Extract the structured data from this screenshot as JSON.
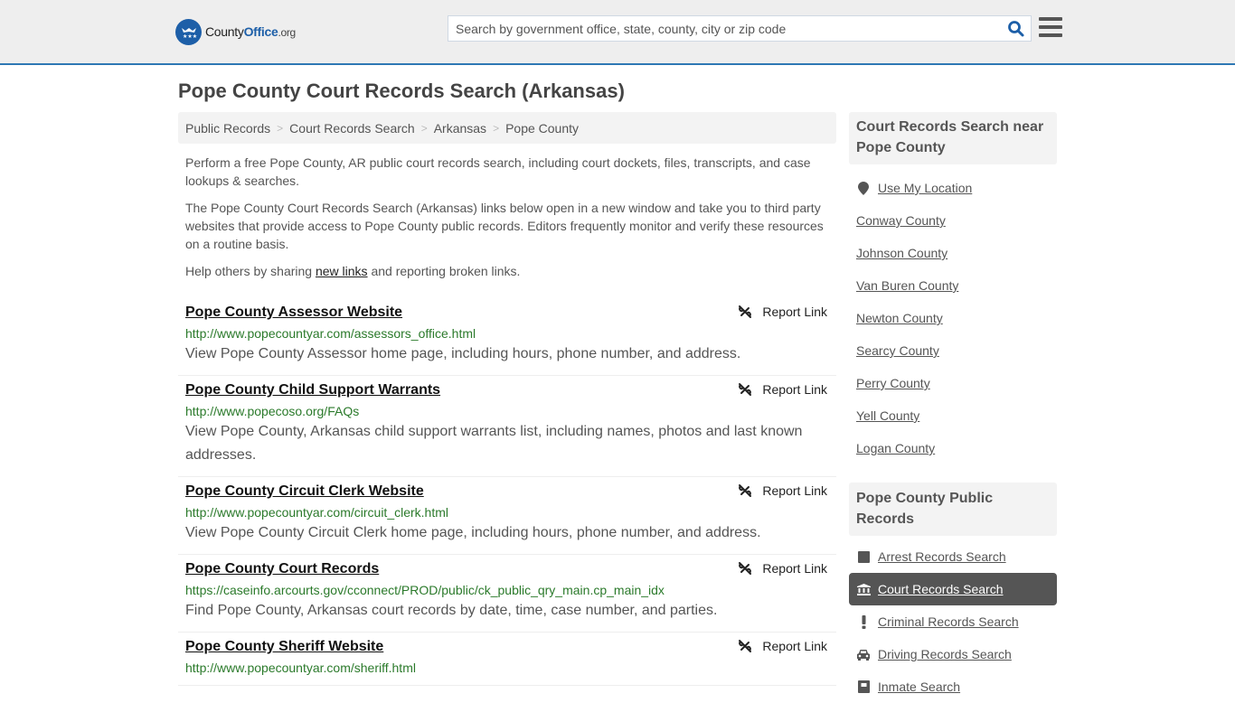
{
  "header": {
    "logo": {
      "part1": "County",
      "part2": "Office",
      "part3": ".org"
    },
    "search_placeholder": "Search by government office, state, county, city or zip code",
    "search_value": "",
    "colors": {
      "brand_blue": "#1d5fa8",
      "header_border": "#2e78b4",
      "url_green": "#2b7a2b"
    }
  },
  "page_title": "Pope County Court Records Search (Arkansas)",
  "breadcrumb": [
    "Public Records",
    "Court Records Search",
    "Arkansas",
    "Pope County"
  ],
  "intro": {
    "p1": "Perform a free Pope County, AR public court records search, including court dockets, files, transcripts, and case lookups & searches.",
    "p2": "The Pope County Court Records Search (Arkansas) links below open in a new window and take you to third party websites that provide access to Pope County public records. Editors frequently monitor and verify these resources on a routine basis.",
    "p3_before": "Help others by sharing ",
    "p3_link": "new links",
    "p3_after": " and reporting broken links."
  },
  "report_label": "Report Link",
  "results": [
    {
      "title": "Pope County Assessor Website",
      "url": "http://www.popecountyar.com/assessors_office.html",
      "desc": "View Pope County Assessor home page, including hours, phone number, and address."
    },
    {
      "title": "Pope County Child Support Warrants",
      "url": "http://www.popecoso.org/FAQs",
      "desc": "View Pope County, Arkansas child support warrants list, including names, photos and last known addresses."
    },
    {
      "title": "Pope County Circuit Clerk Website",
      "url": "http://www.popecountyar.com/circuit_clerk.html",
      "desc": "View Pope County Circuit Clerk home page, including hours, phone number, and address."
    },
    {
      "title": "Pope County Court Records",
      "url": "https://caseinfo.arcourts.gov/cconnect/PROD/public/ck_public_qry_main.cp_main_idx",
      "desc": "Find Pope County, Arkansas court records by date, time, case number, and parties."
    },
    {
      "title": "Pope County Sheriff Website",
      "url": "http://www.popecountyar.com/sheriff.html",
      "desc": ""
    }
  ],
  "sidebar": {
    "nearby_heading": "Court Records Search near Pope County",
    "use_location": "Use My Location",
    "nearby": [
      "Conway County",
      "Johnson County",
      "Van Buren County",
      "Newton County",
      "Searcy County",
      "Perry County",
      "Yell County",
      "Logan County"
    ],
    "public_heading": "Pope County Public Records",
    "public_records": [
      {
        "label": "Arrest Records Search",
        "icon": "square-icon",
        "active": false
      },
      {
        "label": "Court Records Search",
        "icon": "courthouse-icon",
        "active": true
      },
      {
        "label": "Criminal Records Search",
        "icon": "exclamation-icon",
        "active": false
      },
      {
        "label": "Driving Records Search",
        "icon": "car-icon",
        "active": false
      },
      {
        "label": "Inmate Search",
        "icon": "inmate-icon",
        "active": false
      }
    ]
  }
}
